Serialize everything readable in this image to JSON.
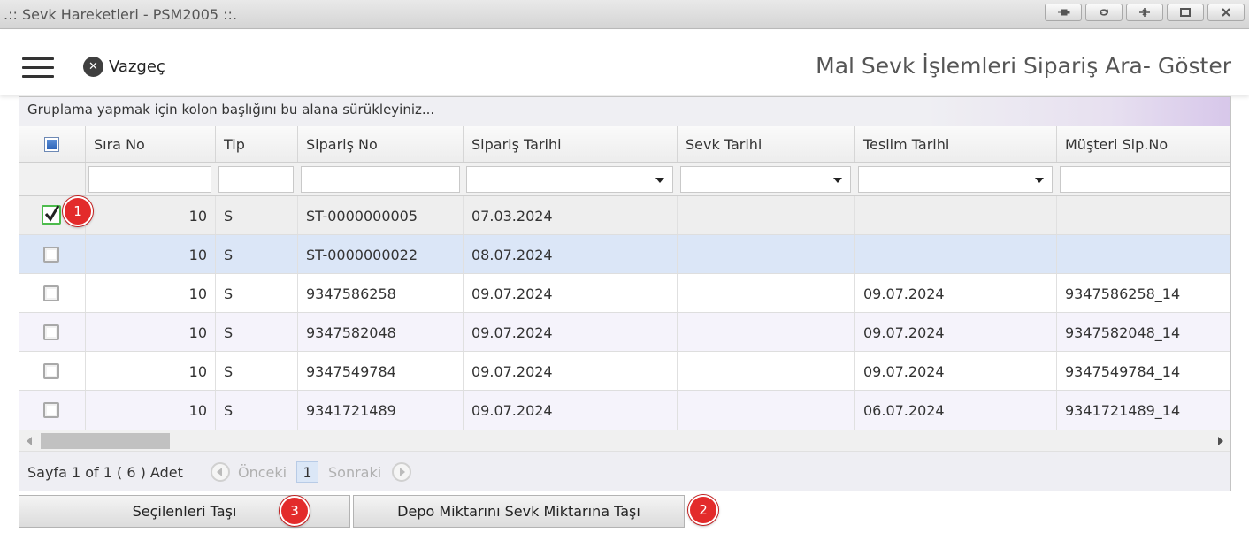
{
  "window": {
    "title": ".:: Sevk Hareketleri - PSM2005 ::.",
    "buttons": [
      "pin-icon",
      "refresh-icon",
      "collapse-icon",
      "maximize-icon",
      "close-icon"
    ]
  },
  "header": {
    "cancel_label": "Vazgeç",
    "page_title": "Mal Sevk İşlemleri Sipariş Ara- Göster"
  },
  "grid": {
    "group_hint": "Gruplama yapmak için kolon başlığını bu alana sürükleyiniz...",
    "columns": [
      "Sıra No",
      "Tip",
      "Sipariş No",
      "Sipariş Tarihi",
      "Sevk Tarihi",
      "Teslim Tarihi",
      "Müşteri Sip.No"
    ],
    "rows": [
      {
        "checked": true,
        "sira": "10",
        "tip": "S",
        "siparis_no": "ST-0000000005",
        "siparis_tarihi": "07.03.2024",
        "sevk_tarihi": "",
        "teslim_tarihi": "",
        "musteri_sip_no": ""
      },
      {
        "checked": false,
        "sira": "10",
        "tip": "S",
        "siparis_no": "ST-0000000022",
        "siparis_tarihi": "08.07.2024",
        "sevk_tarihi": "",
        "teslim_tarihi": "",
        "musteri_sip_no": ""
      },
      {
        "checked": false,
        "sira": "10",
        "tip": "S",
        "siparis_no": "9347586258",
        "siparis_tarihi": "09.07.2024",
        "sevk_tarihi": "",
        "teslim_tarihi": "09.07.2024",
        "musteri_sip_no": "9347586258_14"
      },
      {
        "checked": false,
        "sira": "10",
        "tip": "S",
        "siparis_no": "9347582048",
        "siparis_tarihi": "09.07.2024",
        "sevk_tarihi": "",
        "teslim_tarihi": "09.07.2024",
        "musteri_sip_no": "9347582048_14"
      },
      {
        "checked": false,
        "sira": "10",
        "tip": "S",
        "siparis_no": "9347549784",
        "siparis_tarihi": "09.07.2024",
        "sevk_tarihi": "",
        "teslim_tarihi": "09.07.2024",
        "musteri_sip_no": "9347549784_14"
      },
      {
        "checked": false,
        "sira": "10",
        "tip": "S",
        "siparis_no": "9341721489",
        "siparis_tarihi": "09.07.2024",
        "sevk_tarihi": "",
        "teslim_tarihi": "06.07.2024",
        "musteri_sip_no": "9341721489_14"
      }
    ]
  },
  "pager": {
    "info": "Sayfa 1 of 1 ( 6 ) Adet",
    "prev_label": "Önceki",
    "current_page": "1",
    "next_label": "Sonraki"
  },
  "actions": {
    "move_selected_label": "Seçilenleri Taşı",
    "move_stock_label": "Depo Miktarını Sevk Miktarına Taşı"
  },
  "markers": [
    "1",
    "2",
    "3"
  ],
  "colors": {
    "marker_red": "#e32b2b",
    "selected_row": "#dbe6f7",
    "alt_row": "#f5f3fb",
    "checkbox_checked_border": "#4cbb4c"
  }
}
